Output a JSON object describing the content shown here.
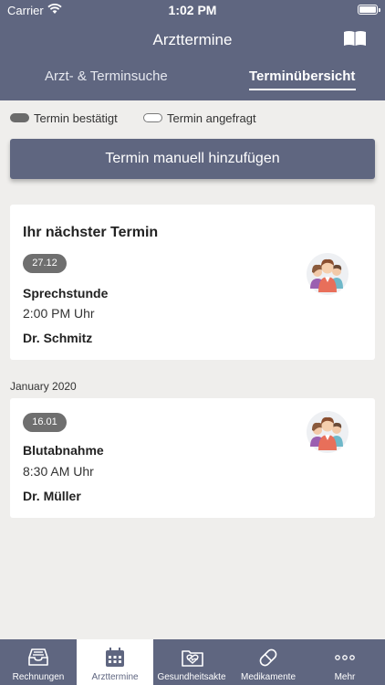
{
  "status": {
    "carrier": "Carrier",
    "time": "1:02 PM"
  },
  "header": {
    "title": "Arzttermine",
    "book_icon": "book-icon"
  },
  "tabs": {
    "left": "Arzt- & Terminsuche",
    "right": "Terminübersicht",
    "active": "right"
  },
  "legend": {
    "confirmed": "Termin bestätigt",
    "requested": "Termin angefragt"
  },
  "add_button": "Termin manuell hinzufügen",
  "next_card": {
    "heading": "Ihr nächster Termin",
    "date": "27.12",
    "type": "Sprechstunde",
    "time": "2:00 PM Uhr",
    "doctor": "Dr. Schmitz"
  },
  "section_label": "January 2020",
  "appointment": {
    "date": "16.01",
    "type": "Blutabnahme",
    "time": "8:30 AM Uhr",
    "doctor": "Dr. Müller"
  },
  "tabbar": [
    {
      "label": "Rechnungen",
      "icon": "inbox-tray-icon"
    },
    {
      "label": "Arzttermine",
      "icon": "calendar-icon",
      "active": true
    },
    {
      "label": "Gesundheitsakte",
      "icon": "health-folder-icon"
    },
    {
      "label": "Medikamente",
      "icon": "pill-icon"
    },
    {
      "label": "Mehr",
      "icon": "more-dots-icon"
    }
  ],
  "colors": {
    "brand": "#5f6680",
    "badge": "#6f6f6f",
    "background": "#efeeec"
  }
}
